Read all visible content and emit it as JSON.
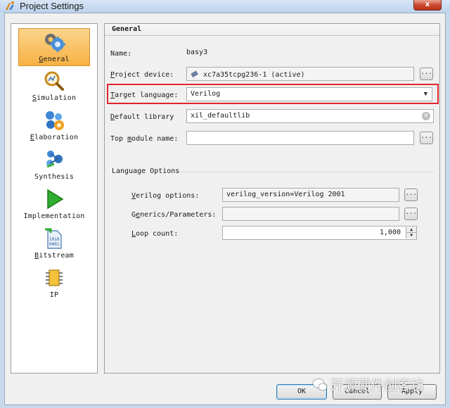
{
  "window": {
    "title": "Project Settings",
    "close_glyph": "x"
  },
  "sidebar": {
    "items": [
      {
        "label_first": "G",
        "label_rest": "eneral",
        "icon": "general-gears-icon",
        "selected": true
      },
      {
        "label_first": "S",
        "label_rest": "imulation",
        "icon": "simulation-magnifier-icon",
        "selected": false
      },
      {
        "label_first": "E",
        "label_rest": "laboration",
        "icon": "elaboration-molecule-icon",
        "selected": false
      },
      {
        "label_first": "",
        "label_rest": "Synthesis",
        "icon": "synthesis-molecule-icon",
        "selected": false
      },
      {
        "label_first": "",
        "label_rest": "Implementation",
        "icon": "implementation-play-icon",
        "selected": false
      },
      {
        "label_first": "B",
        "label_rest": "itstream",
        "icon": "bitstream-file-icon",
        "selected": false
      },
      {
        "label_first": "",
        "label_rest": "IP",
        "icon": "ip-chip-icon",
        "selected": false
      }
    ]
  },
  "general": {
    "heading": "General",
    "name_label": "Name:",
    "name_value": "basy3",
    "device_label_first": "P",
    "device_label_rest": "roject device:",
    "device_value": "xc7a35tcpg236-1 (active)",
    "device_browse": "...",
    "target_label_first": "T",
    "target_label_rest": "arget language:",
    "target_value": "Verilog",
    "library_label_first": "D",
    "library_label_rest": "efault library",
    "library_value": "xil_defaultlib",
    "top_label_pre": "Top ",
    "top_label_ul": "m",
    "top_label_post": "odule name:",
    "top_value": "",
    "top_browse": "...",
    "lang_options_title": "Language Options",
    "verilog_label_first": "V",
    "verilog_label_rest": "erilog options:",
    "verilog_value": "verilog_version=Verilog 2001",
    "verilog_browse": "...",
    "generics_label_pre": "G",
    "generics_label_ul": "e",
    "generics_label_post": "nerics/Parameters:",
    "generics_value": "",
    "generics_browse": "...",
    "loop_label_first": "L",
    "loop_label_rest": "oop count:",
    "loop_value": "1,000"
  },
  "buttons": {
    "ok": "OK",
    "cancel": "Cancel",
    "apply": "Apply"
  },
  "watermark": "开源硬件创客坊",
  "colors": {
    "highlight": "#e0262b",
    "selected_bg": "#f8b144",
    "window_chrome": "#c9d9ec"
  }
}
